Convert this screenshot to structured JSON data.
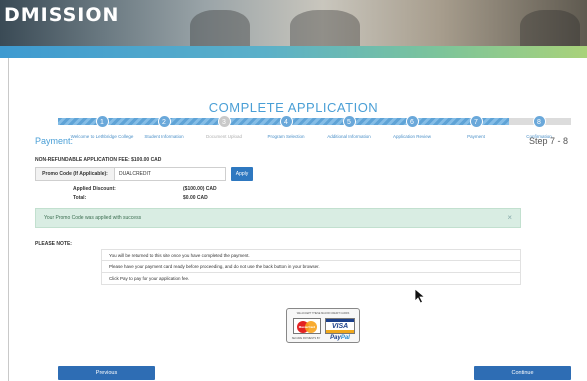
{
  "banner": {
    "title": "DMISSION"
  },
  "page": {
    "heading": "COMPLETE APPLICATION"
  },
  "stepper": {
    "steps": [
      {
        "number": "1",
        "label": "Welcome to Lethbridge College",
        "state": "done"
      },
      {
        "number": "2",
        "label": "Student Information",
        "state": "done"
      },
      {
        "number": "3",
        "label": "Document Upload",
        "state": "disabled"
      },
      {
        "number": "4",
        "label": "Program Selection",
        "state": "done"
      },
      {
        "number": "5",
        "label": "Additional Information",
        "state": "done"
      },
      {
        "number": "6",
        "label": "Application Review",
        "state": "done"
      },
      {
        "number": "7",
        "label": "Payment",
        "state": "done"
      },
      {
        "number": "8",
        "label": "Confirmation",
        "state": "current"
      }
    ]
  },
  "payment": {
    "title": "Payment:",
    "step_count": "Step 7 - 8",
    "fee_line": "NON-REFUNDABLE APPLICATION FEE: $100.00 CAD",
    "promo_label": "Promo Code (If Applicable):",
    "promo_value": "DUALCREDIT",
    "apply_label": "Apply",
    "discount_label": "Applied Discount:",
    "discount_value": "($100.00) CAD",
    "total_label": "Total:",
    "total_value": "$0.00 CAD"
  },
  "alert": {
    "message": "Your Promo Code was applied with success",
    "close_glyph": "×"
  },
  "note": {
    "title": "PLEASE NOTE:",
    "items": [
      "You will be returned to this site once you have completed the payment.",
      "Please have your payment card ready before proceeding, and do not use the back button in your browser.",
      "Click Pay to pay for your application fee."
    ]
  },
  "cards": {
    "top_text": "WE ACCEPT THESE MAJOR CREDIT CARDS",
    "bottom_text": "SECURE PAYMENTS BY",
    "mastercard": "MasterCard",
    "visa": "VISA",
    "paypal_a": "Pay",
    "paypal_b": "Pal"
  },
  "nav": {
    "previous_label": "Previous",
    "continue_label": "Continue"
  },
  "colors": {
    "accent": "#4a9fd6",
    "button": "#2e6db4",
    "success_bg": "#d9ede3"
  }
}
